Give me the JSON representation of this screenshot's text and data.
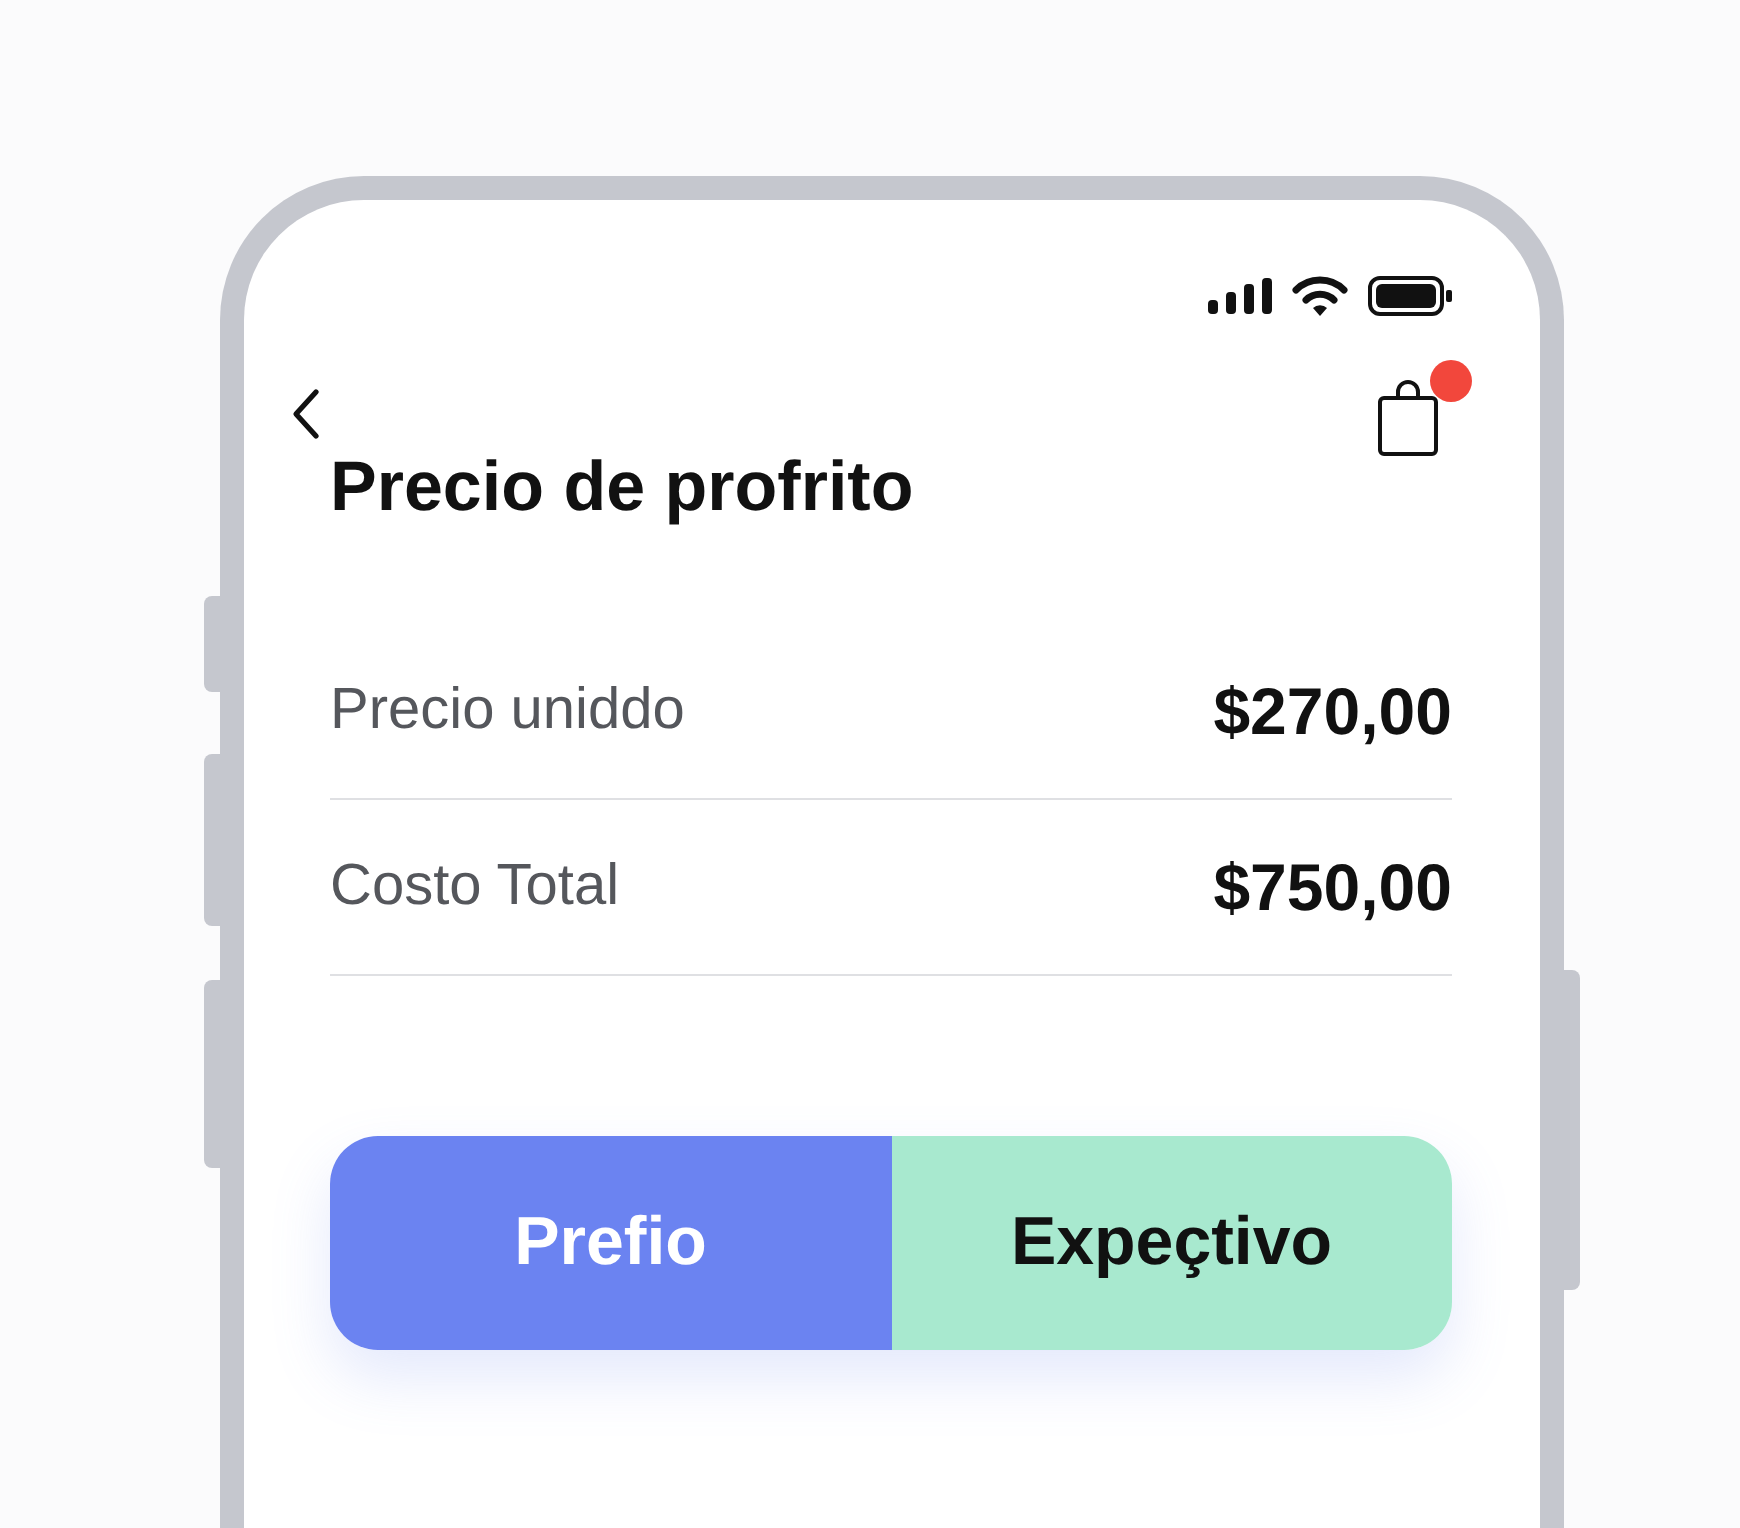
{
  "screen": {
    "title": "Precio de profrito",
    "cart": {
      "has_notification": true
    }
  },
  "rows": [
    {
      "label": "Precio uniddo",
      "value": "$270,00"
    },
    {
      "label": "Costo Total",
      "value": "$750,00"
    }
  ],
  "segments": [
    {
      "label": "Prefio",
      "kind": "primary",
      "color": "#6b83f1"
    },
    {
      "label": "Expeçtivo",
      "kind": "secondary",
      "color": "#a8e9cf"
    }
  ]
}
